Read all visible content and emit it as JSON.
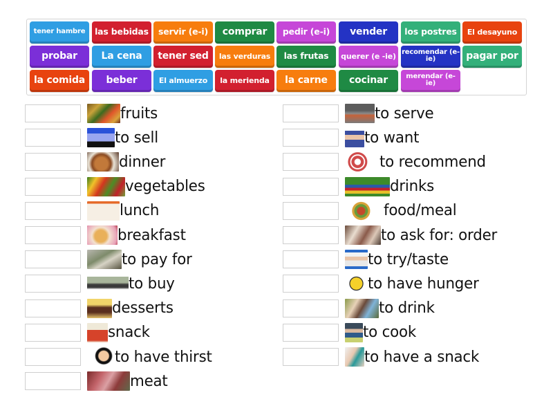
{
  "colors": {
    "blue": "#2f9ee3",
    "red": "#d2202f",
    "orange": "#f77d0e",
    "green": "#1f8a44",
    "magenta": "#c647d8",
    "navy": "#2433c4",
    "teal": "#33b07a",
    "redorange": "#e8430f",
    "purple": "#7b2fd8"
  },
  "word_bank": [
    {
      "label": "tener hambre",
      "color": "blue"
    },
    {
      "label": "las bebidas",
      "color": "red"
    },
    {
      "label": "servir (e-i)",
      "color": "orange"
    },
    {
      "label": "comprar",
      "color": "green"
    },
    {
      "label": "pedir (e-i)",
      "color": "magenta"
    },
    {
      "label": "vender",
      "color": "navy"
    },
    {
      "label": "los postres",
      "color": "teal"
    },
    {
      "label": "El desayuno",
      "color": "redorange"
    },
    {
      "label": "probar",
      "color": "purple"
    },
    {
      "label": "La cena",
      "color": "blue"
    },
    {
      "label": "tener sed",
      "color": "red"
    },
    {
      "label": "las verduras",
      "color": "orange"
    },
    {
      "label": "las frutas",
      "color": "green"
    },
    {
      "label": "querer (e -ie)",
      "color": "magenta"
    },
    {
      "label": "recomendar (e-ie)",
      "color": "navy"
    },
    {
      "label": "pagar por",
      "color": "teal"
    },
    {
      "label": "la comida",
      "color": "redorange"
    },
    {
      "label": "beber",
      "color": "purple"
    },
    {
      "label": "El almuerzo",
      "color": "blue"
    },
    {
      "label": "la merienda",
      "color": "red"
    },
    {
      "label": "la carne",
      "color": "orange"
    },
    {
      "label": "cocinar",
      "color": "green"
    },
    {
      "label": "merendar (e-ie)",
      "color": "magenta"
    }
  ],
  "left_items": [
    {
      "prompt": "fruits",
      "image": "fruits-photo",
      "answer": ""
    },
    {
      "prompt": "to sell",
      "image": "sell-sign-cartoon",
      "answer": ""
    },
    {
      "prompt": "dinner",
      "image": "roast-turkey-dinner-photo",
      "answer": ""
    },
    {
      "prompt": "vegetables",
      "image": "vegetables-photo",
      "answer": ""
    },
    {
      "prompt": "lunch",
      "image": "lunch-tray-photo",
      "answer": ""
    },
    {
      "prompt": "breakfast",
      "image": "pancakes-photo",
      "answer": ""
    },
    {
      "prompt": "to pay for",
      "image": "paying-cash-photo",
      "answer": ""
    },
    {
      "prompt": "to buy",
      "image": "money-for-key-photo",
      "answer": ""
    },
    {
      "prompt": "desserts",
      "image": "cake-slice-photo",
      "answer": ""
    },
    {
      "prompt": "snack",
      "image": "popcorn-snack-icon",
      "answer": ""
    },
    {
      "prompt": "to have thirst",
      "image": "thirsty-cartoon",
      "answer": ""
    },
    {
      "prompt": "meat",
      "image": "raw-meat-photo",
      "answer": ""
    }
  ],
  "right_items": [
    {
      "prompt": "to serve",
      "image": "serve-hands-photo",
      "answer": ""
    },
    {
      "prompt": "to want",
      "image": "uncle-sam-want-photo",
      "answer": ""
    },
    {
      "prompt": "to recommend",
      "image": "recommended-stamp-icon",
      "answer": ""
    },
    {
      "prompt": "drinks",
      "image": "fruit-drinks-photo",
      "answer": ""
    },
    {
      "prompt": "food/meal",
      "image": "food-plate-chart",
      "answer": ""
    },
    {
      "prompt": "to ask for: order",
      "image": "restaurant-order-photo",
      "answer": ""
    },
    {
      "prompt": "to try/taste",
      "image": "chef-boy-tasting-photo",
      "answer": ""
    },
    {
      "prompt": "to have hunger",
      "image": "hungry-face-emoji",
      "answer": ""
    },
    {
      "prompt": "to drink",
      "image": "woman-drinking-photo",
      "answer": ""
    },
    {
      "prompt": "to cook",
      "image": "man-cooking-photo",
      "answer": ""
    },
    {
      "prompt": "to have a snack",
      "image": "snacking-person-photo",
      "answer": ""
    }
  ]
}
